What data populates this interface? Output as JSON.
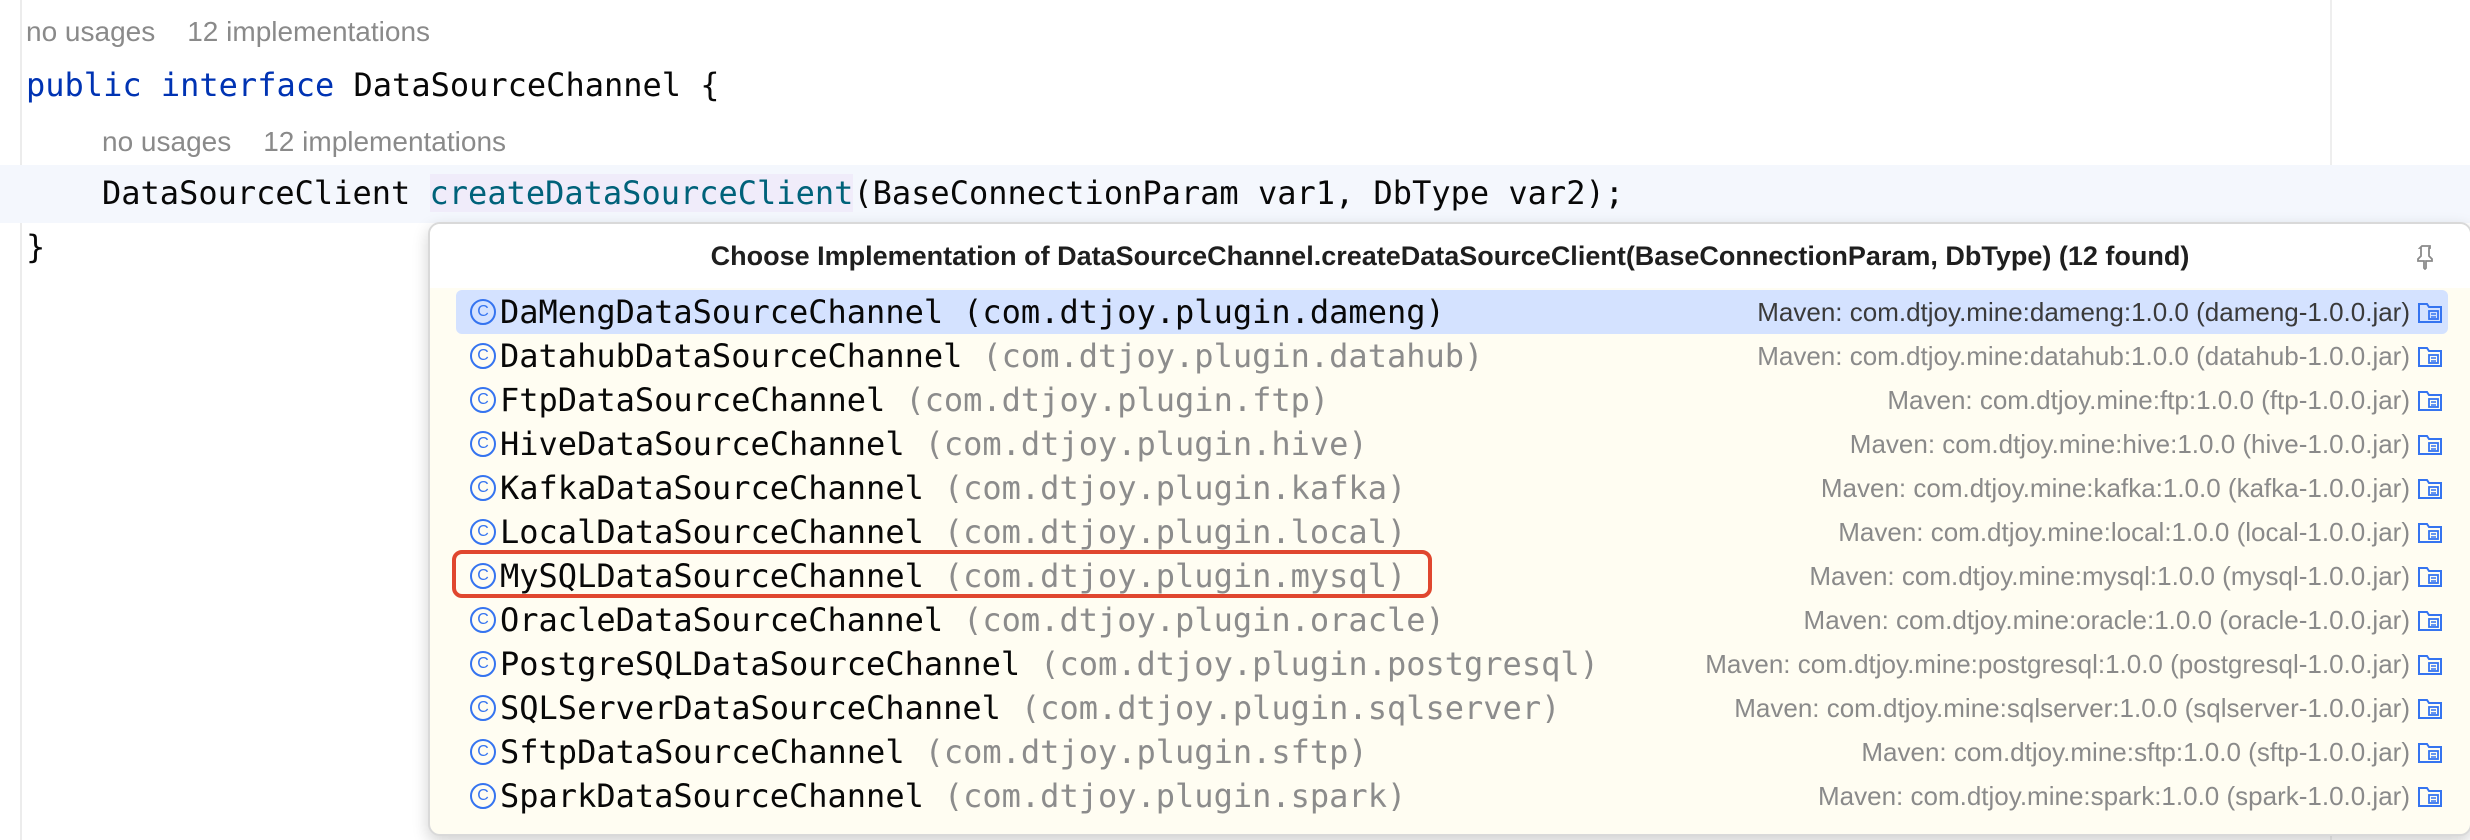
{
  "editor": {
    "hint_top": {
      "usages": "no usages",
      "impls": "12 implementations"
    },
    "line1": {
      "kw1": "public",
      "kw2": "interface",
      "name": "DataSourceChannel {"
    },
    "hint_inner": {
      "usages": "no usages",
      "impls": "12 implementations"
    },
    "line2": {
      "type": "DataSourceClient",
      "method": "createDataSourceClient",
      "params": "(BaseConnectionParam var1, DbType var2);"
    },
    "line3": "}"
  },
  "popup": {
    "title": "Choose Implementation of DataSourceChannel.createDataSourceClient(BaseConnectionParam, DbType) (12 found)",
    "icons": {
      "header": "pin-icon",
      "class": "class-icon",
      "library": "library-jar-icon"
    },
    "class_icon_glyph": "C",
    "items": [
      {
        "name": "DaMengDataSourceChannel",
        "pkg": "(com.dtjoy.plugin.dameng)",
        "loc": "Maven: com.dtjoy.mine:dameng:1.0.0 (dameng-1.0.0.jar)"
      },
      {
        "name": "DatahubDataSourceChannel",
        "pkg": "(com.dtjoy.plugin.datahub)",
        "loc": "Maven: com.dtjoy.mine:datahub:1.0.0 (datahub-1.0.0.jar)"
      },
      {
        "name": "FtpDataSourceChannel",
        "pkg": "(com.dtjoy.plugin.ftp)",
        "loc": "Maven: com.dtjoy.mine:ftp:1.0.0 (ftp-1.0.0.jar)"
      },
      {
        "name": "HiveDataSourceChannel",
        "pkg": "(com.dtjoy.plugin.hive)",
        "loc": "Maven: com.dtjoy.mine:hive:1.0.0 (hive-1.0.0.jar)"
      },
      {
        "name": "KafkaDataSourceChannel",
        "pkg": "(com.dtjoy.plugin.kafka)",
        "loc": "Maven: com.dtjoy.mine:kafka:1.0.0 (kafka-1.0.0.jar)"
      },
      {
        "name": "LocalDataSourceChannel",
        "pkg": "(com.dtjoy.plugin.local)",
        "loc": "Maven: com.dtjoy.mine:local:1.0.0 (local-1.0.0.jar)"
      },
      {
        "name": "MySQLDataSourceChannel",
        "pkg": "(com.dtjoy.plugin.mysql)",
        "loc": "Maven: com.dtjoy.mine:mysql:1.0.0 (mysql-1.0.0.jar)"
      },
      {
        "name": "OracleDataSourceChannel",
        "pkg": "(com.dtjoy.plugin.oracle)",
        "loc": "Maven: com.dtjoy.mine:oracle:1.0.0 (oracle-1.0.0.jar)"
      },
      {
        "name": "PostgreSQLDataSourceChannel",
        "pkg": "(com.dtjoy.plugin.postgresql)",
        "loc": "Maven: com.dtjoy.mine:postgresql:1.0.0 (postgresql-1.0.0.jar)"
      },
      {
        "name": "SQLServerDataSourceChannel",
        "pkg": "(com.dtjoy.plugin.sqlserver)",
        "loc": "Maven: com.dtjoy.mine:sqlserver:1.0.0 (sqlserver-1.0.0.jar)"
      },
      {
        "name": "SftpDataSourceChannel",
        "pkg": "(com.dtjoy.plugin.sftp)",
        "loc": "Maven: com.dtjoy.mine:sftp:1.0.0 (sftp-1.0.0.jar)"
      },
      {
        "name": "SparkDataSourceChannel",
        "pkg": "(com.dtjoy.plugin.spark)",
        "loc": "Maven: com.dtjoy.mine:spark:1.0.0 (spark-1.0.0.jar)"
      }
    ]
  },
  "colors": {
    "keyword": "#0033b3",
    "method": "#00627a",
    "selection": "#d4e2ff",
    "highlight_box": "#e0472f",
    "popup_bg": "#fffdf2"
  }
}
